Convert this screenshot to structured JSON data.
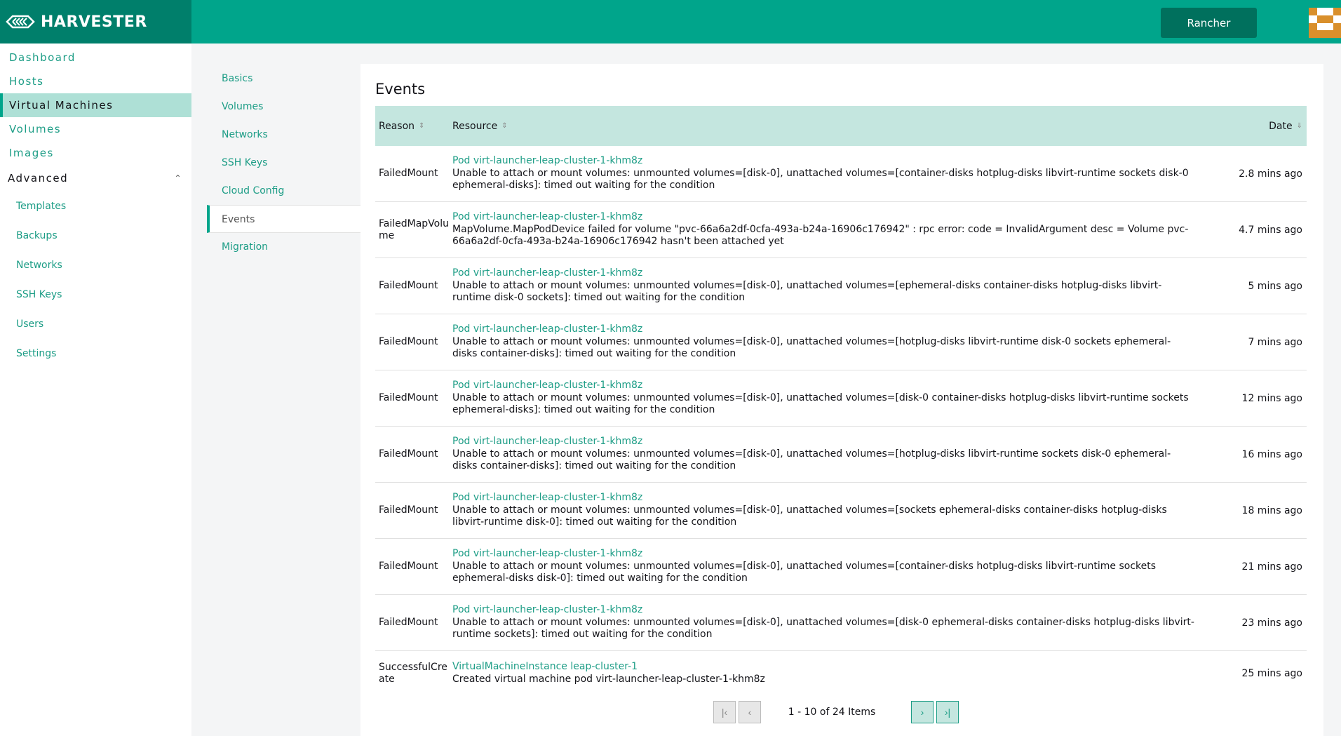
{
  "header": {
    "brand": "HARVESTER",
    "rancher_label": "Rancher",
    "colors": {
      "header": "#00a58b",
      "brand_bg": "#007f6b",
      "accent": "#00a58b"
    }
  },
  "leftnav": {
    "items": [
      {
        "label": "Dashboard"
      },
      {
        "label": "Hosts"
      },
      {
        "label": "Virtual Machines",
        "active": true
      },
      {
        "label": "Volumes"
      },
      {
        "label": "Images"
      }
    ],
    "group_label": "Advanced",
    "subitems": [
      {
        "label": "Templates"
      },
      {
        "label": "Backups"
      },
      {
        "label": "Networks"
      },
      {
        "label": "SSH Keys"
      },
      {
        "label": "Users"
      },
      {
        "label": "Settings"
      }
    ]
  },
  "tabs": [
    {
      "label": "Basics"
    },
    {
      "label": "Volumes"
    },
    {
      "label": "Networks"
    },
    {
      "label": "SSH Keys"
    },
    {
      "label": "Cloud Config"
    },
    {
      "label": "Events",
      "active": true
    },
    {
      "label": "Migration"
    }
  ],
  "events": {
    "title": "Events",
    "columns": {
      "reason": "Reason",
      "resource": "Resource",
      "date": "Date"
    },
    "rows": [
      {
        "reason": "FailedMount",
        "resource": "Pod virt-launcher-leap-cluster-1-khm8z",
        "message": "Unable to attach or mount volumes: unmounted volumes=[disk-0], unattached volumes=[container-disks hotplug-disks libvirt-runtime sockets disk-0 ephemeral-disks]: timed out waiting for the condition",
        "date": "2.8 mins ago"
      },
      {
        "reason": "FailedMapVolume",
        "resource": "Pod virt-launcher-leap-cluster-1-khm8z",
        "message": "MapVolume.MapPodDevice failed for volume \"pvc-66a6a2df-0cfa-493a-b24a-16906c176942\" : rpc error: code = InvalidArgument desc = Volume pvc-66a6a2df-0cfa-493a-b24a-16906c176942 hasn't been attached yet",
        "date": "4.7 mins ago"
      },
      {
        "reason": "FailedMount",
        "resource": "Pod virt-launcher-leap-cluster-1-khm8z",
        "message": "Unable to attach or mount volumes: unmounted volumes=[disk-0], unattached volumes=[ephemeral-disks container-disks hotplug-disks libvirt-runtime disk-0 sockets]: timed out waiting for the condition",
        "date": "5 mins ago"
      },
      {
        "reason": "FailedMount",
        "resource": "Pod virt-launcher-leap-cluster-1-khm8z",
        "message": "Unable to attach or mount volumes: unmounted volumes=[disk-0], unattached volumes=[hotplug-disks libvirt-runtime disk-0 sockets ephemeral-disks container-disks]: timed out waiting for the condition",
        "date": "7 mins ago"
      },
      {
        "reason": "FailedMount",
        "resource": "Pod virt-launcher-leap-cluster-1-khm8z",
        "message": "Unable to attach or mount volumes: unmounted volumes=[disk-0], unattached volumes=[disk-0 container-disks hotplug-disks libvirt-runtime sockets ephemeral-disks]: timed out waiting for the condition",
        "date": "12 mins ago"
      },
      {
        "reason": "FailedMount",
        "resource": "Pod virt-launcher-leap-cluster-1-khm8z",
        "message": "Unable to attach or mount volumes: unmounted volumes=[disk-0], unattached volumes=[hotplug-disks libvirt-runtime sockets disk-0 ephemeral-disks container-disks]: timed out waiting for the condition",
        "date": "16 mins ago"
      },
      {
        "reason": "FailedMount",
        "resource": "Pod virt-launcher-leap-cluster-1-khm8z",
        "message": "Unable to attach or mount volumes: unmounted volumes=[disk-0], unattached volumes=[sockets ephemeral-disks container-disks hotplug-disks libvirt-runtime disk-0]: timed out waiting for the condition",
        "date": "18 mins ago"
      },
      {
        "reason": "FailedMount",
        "resource": "Pod virt-launcher-leap-cluster-1-khm8z",
        "message": "Unable to attach or mount volumes: unmounted volumes=[disk-0], unattached volumes=[container-disks hotplug-disks libvirt-runtime sockets ephemeral-disks disk-0]: timed out waiting for the condition",
        "date": "21 mins ago"
      },
      {
        "reason": "FailedMount",
        "resource": "Pod virt-launcher-leap-cluster-1-khm8z",
        "message": "Unable to attach or mount volumes: unmounted volumes=[disk-0], unattached volumes=[disk-0 ephemeral-disks container-disks hotplug-disks libvirt-runtime sockets]: timed out waiting for the condition",
        "date": "23 mins ago"
      },
      {
        "reason": "SuccessfulCreate",
        "resource": "VirtualMachineInstance leap-cluster-1",
        "message": "Created virtual machine pod virt-launcher-leap-cluster-1-khm8z",
        "date": "25 mins ago"
      }
    ]
  },
  "pagination": {
    "info": "1 - 10 of 24 Items",
    "first_icon": "first-page-icon",
    "prev_icon": "prev-page-icon",
    "next_icon": "next-page-icon",
    "last_icon": "last-page-icon"
  }
}
